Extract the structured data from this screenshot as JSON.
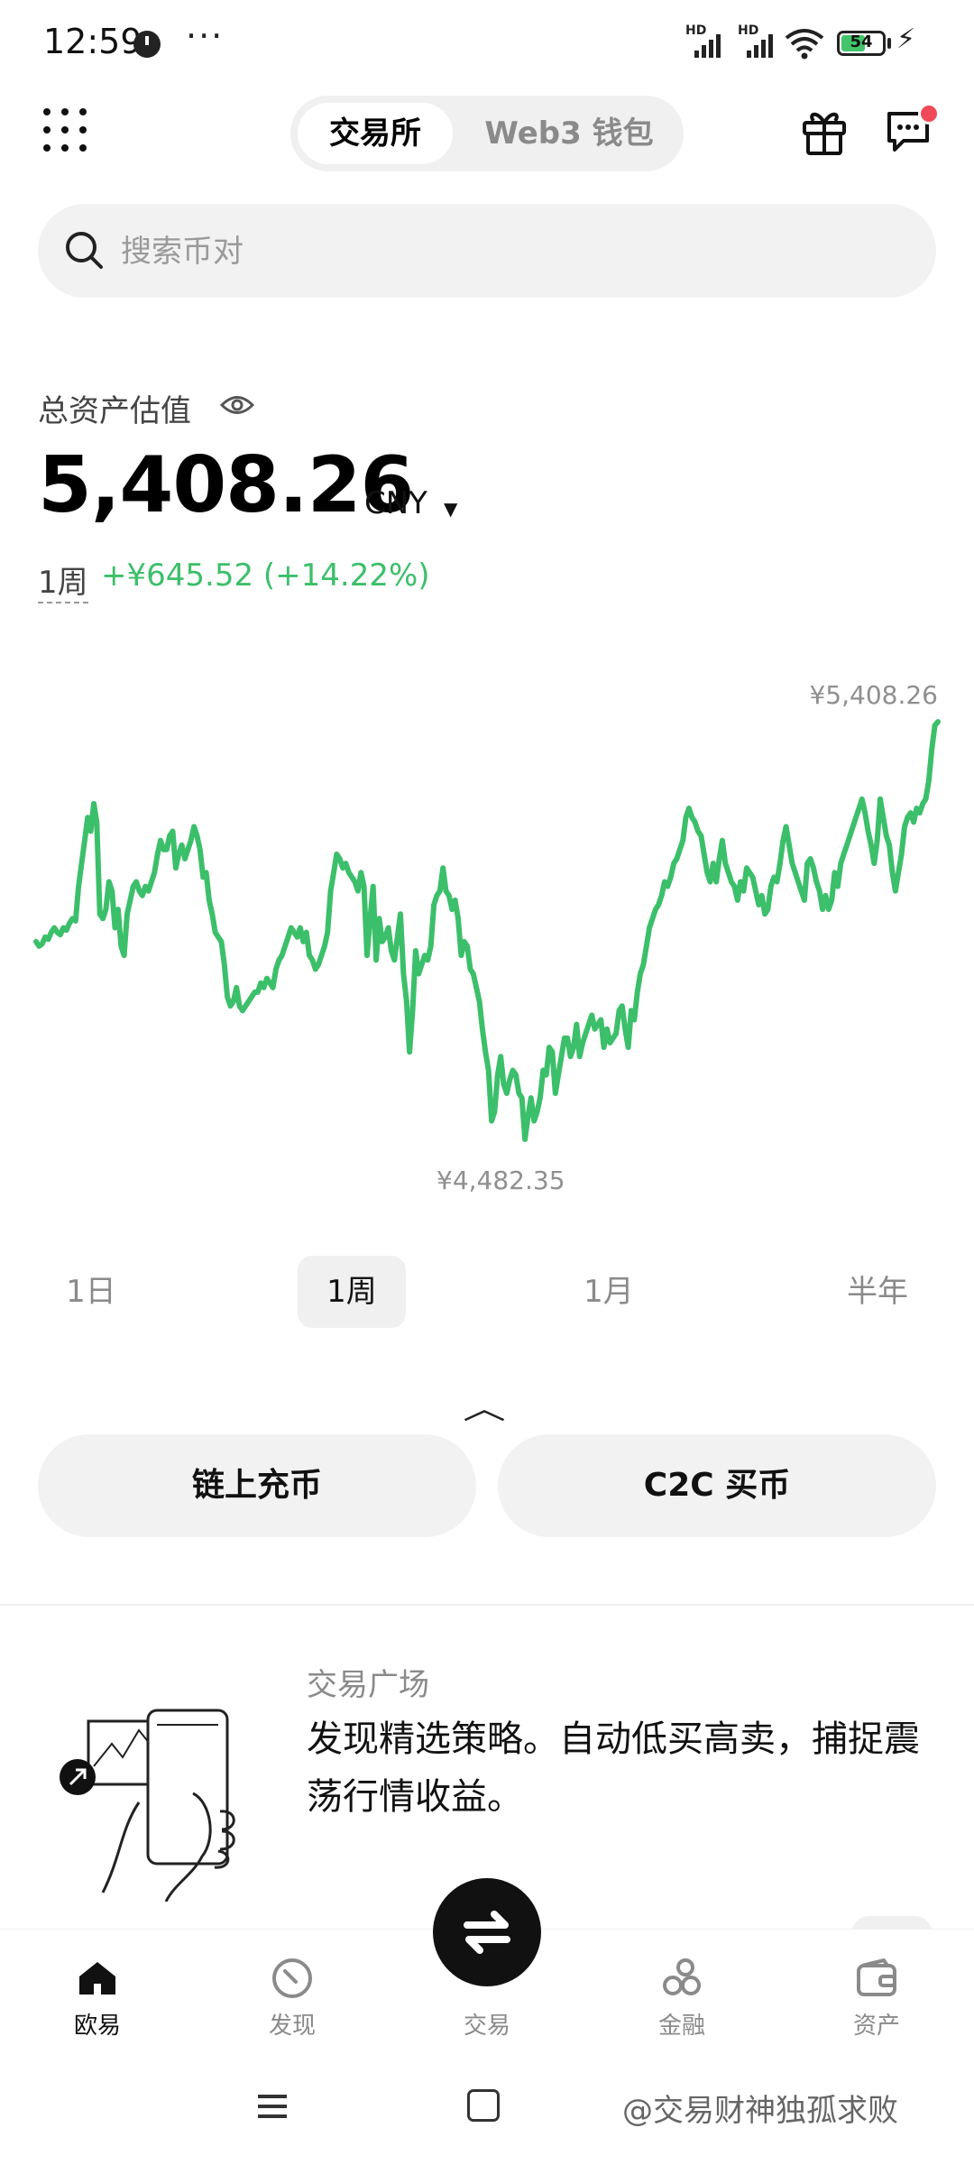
{
  "status_bar": {
    "time": "12:59",
    "dots": "···",
    "battery": "54",
    "hd1": "HD",
    "hd2": "HD"
  },
  "header": {
    "tab_exchange": "交易所",
    "tab_web3": "Web3 钱包"
  },
  "search": {
    "placeholder": "搜索币对"
  },
  "assets": {
    "label": "总资产估值",
    "balance": "5,408.26",
    "currency": "CNY",
    "pnl_period": "1周",
    "pnl_value": "+¥645.52 (+14.22%)"
  },
  "chart_data": {
    "type": "line",
    "max_label": "¥5,408.26",
    "min_label": "¥4,482.35",
    "color": "#3cbf6a",
    "values": [
      4930,
      4920,
      4925,
      4940,
      4935,
      4950,
      4960,
      4950,
      4945,
      4960,
      4955,
      4970,
      4980,
      4975,
      5050,
      5100,
      5150,
      5200,
      5170,
      5230,
      5190,
      4990,
      4980,
      5000,
      5060,
      5040,
      4960,
      5000,
      4920,
      4900,
      4990,
      5020,
      5050,
      5060,
      5040,
      5030,
      5050,
      5040,
      5060,
      5080,
      5120,
      5150,
      5130,
      5130,
      5160,
      5170,
      5090,
      5120,
      5140,
      5110,
      5130,
      5150,
      5180,
      5160,
      5130,
      5070,
      5080,
      5020,
      4990,
      4950,
      4940,
      4930,
      4880,
      4810,
      4790,
      4800,
      4830,
      4790,
      4780,
      4790,
      4800,
      4810,
      4820,
      4820,
      4840,
      4830,
      4850,
      4840,
      4830,
      4870,
      4890,
      4900,
      4920,
      4940,
      4960,
      4950,
      4940,
      4960,
      4930,
      4950,
      4900,
      4890,
      4870,
      4880,
      4900,
      4920,
      4950,
      5040,
      5080,
      5120,
      5110,
      5090,
      5100,
      5080,
      5070,
      5060,
      5040,
      5080,
      5050,
      4900,
      4980,
      5050,
      4890,
      4980,
      4930,
      4940,
      4960,
      4910,
      4890,
      4940,
      4990,
      4860,
      4800,
      4690,
      4780,
      4910,
      4860,
      4880,
      4900,
      4890,
      4920,
      5010,
      5030,
      5040,
      5090,
      5040,
      5030,
      5000,
      5020,
      4980,
      4900,
      4930,
      4920,
      4870,
      4860,
      4830,
      4800,
      4740,
      4690,
      4650,
      4540,
      4560,
      4640,
      4680,
      4620,
      4600,
      4630,
      4650,
      4640,
      4600,
      4590,
      4500,
      4550,
      4590,
      4540,
      4560,
      4590,
      4650,
      4640,
      4700,
      4690,
      4600,
      4640,
      4680,
      4720,
      4720,
      4680,
      4700,
      4750,
      4680,
      4710,
      4730,
      4750,
      4770,
      4740,
      4750,
      4760,
      4700,
      4740,
      4710,
      4720,
      4730,
      4780,
      4790,
      4740,
      4700,
      4780,
      4760,
      4820,
      4860,
      4880,
      4920,
      4960,
      4980,
      5000,
      5010,
      5030,
      5060,
      5050,
      5070,
      5100,
      5110,
      5130,
      5150,
      5200,
      5220,
      5200,
      5190,
      5170,
      5160,
      5120,
      5080,
      5060,
      5100,
      5060,
      5110,
      5150,
      5100,
      5080,
      5060,
      5050,
      5020,
      5060,
      5040,
      5090,
      5080,
      5070,
      5040,
      5010,
      5030,
      4990,
      5000,
      5050,
      5070,
      5060,
      5100,
      5150,
      5180,
      5140,
      5100,
      5080,
      5060,
      5040,
      5020,
      5100,
      5110,
      5090,
      5060,
      5040,
      5000,
      5030,
      5000,
      5020,
      5080,
      5050,
      5100,
      5120,
      5140,
      5160,
      5180,
      5200,
      5220,
      5240,
      5210,
      5170,
      5140,
      5100,
      5150,
      5240,
      5200,
      5160,
      5140,
      5080,
      5040,
      5080,
      5120,
      5180,
      5200,
      5210,
      5190,
      5220,
      5210,
      5230,
      5240,
      5280,
      5350,
      5400,
      5408
    ]
  },
  "periods": [
    "1日",
    "1周",
    "1月",
    "半年"
  ],
  "actions": {
    "deposit": "链上充币",
    "c2c": "C2C 买币"
  },
  "promo": {
    "label": "交易广场",
    "text": "发现精选策略。自动低买高卖，捕捉震荡行情收益。"
  },
  "nav": {
    "home": "欧易",
    "discover": "发现",
    "trade": "交易",
    "finance": "金融",
    "assets": "资产"
  },
  "watermark": "@交易财神独孤求败"
}
